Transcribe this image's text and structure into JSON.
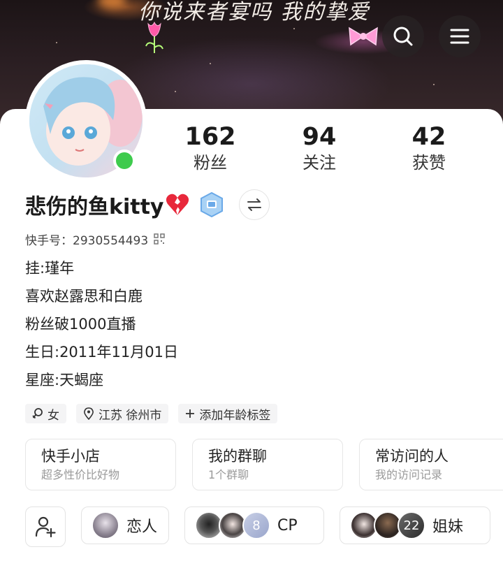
{
  "banner": {
    "text": "你说来者宴吗   我的挚爱"
  },
  "toolbar": {
    "search_icon": "search-icon",
    "menu_icon": "menu-icon"
  },
  "stats": [
    {
      "value": "162",
      "label": "粉丝"
    },
    {
      "value": "94",
      "label": "关注"
    },
    {
      "value": "42",
      "label": "获赞"
    }
  ],
  "profile": {
    "name": "悲伤的鱼kitty",
    "name_emoji": "💔",
    "kuaishou_id": "快手号：2930554493",
    "online": true,
    "online_color": "#3ecb4d"
  },
  "bio": [
    "挂:瑾年",
    "喜欢赵露思和白鹿",
    "粉丝破1000直播",
    "生日:2011年11月01日",
    "星座:天蝎座"
  ],
  "tags": {
    "gender": "女",
    "location": "江苏 徐州市",
    "add_age": "添加年龄标签"
  },
  "cards": [
    {
      "title": "快手小店",
      "subtitle": "超多性价比好物"
    },
    {
      "title": "我的群聊",
      "subtitle": "1个群聊"
    },
    {
      "title": "常访问的人",
      "subtitle": "我的访问记录"
    }
  ],
  "relations": {
    "lover": "恋人",
    "cp": "CP",
    "cp_count": "8",
    "sisters": "姐妹",
    "sisters_count": "22"
  }
}
